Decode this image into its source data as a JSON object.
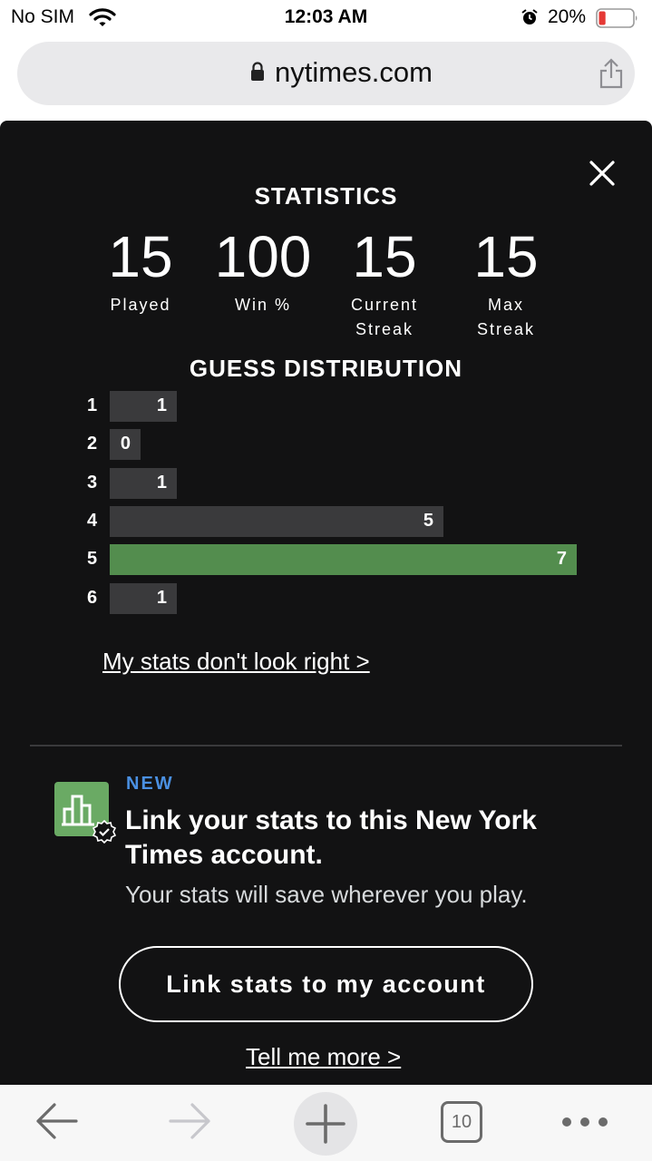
{
  "status_bar": {
    "carrier": "No SIM",
    "time": "12:03 AM",
    "battery_percent": "20%",
    "battery_level": 0.2,
    "icons": [
      "wifi-icon",
      "alarm-icon",
      "battery-icon"
    ]
  },
  "browser": {
    "url": "nytimes.com",
    "tab_count": "10",
    "icons": [
      "lock-icon",
      "share-icon",
      "back-arrow-icon",
      "forward-arrow-icon",
      "plus-icon",
      "more-dots-icon"
    ]
  },
  "modal": {
    "stats_title": "STATISTICS",
    "stats": [
      {
        "value": "15",
        "label": "Played"
      },
      {
        "value": "100",
        "label": "Win %"
      },
      {
        "value": "15",
        "label": "Current\nStreak"
      },
      {
        "value": "15",
        "label": "Max\nStreak"
      }
    ],
    "distribution_title": "GUESS DISTRIBUTION",
    "chart_data": {
      "type": "bar",
      "categories": [
        "1",
        "2",
        "3",
        "4",
        "5",
        "6"
      ],
      "values": [
        1,
        0,
        1,
        5,
        7,
        1
      ],
      "highlighted_category": "5",
      "colors": {
        "bar": "#3a3a3c",
        "highlight": "#538d4e"
      }
    },
    "stats_link": "My stats don't look right >",
    "promo": {
      "badge": "NEW",
      "title": "Link your stats to this New York Times account.",
      "subtitle": "Your stats will save wherever you play.",
      "button_label": "Link stats to my account",
      "more_link": "Tell me more >"
    },
    "colors": {
      "background": "#121213",
      "accent_green": "#6aaa64",
      "new_badge": "#4a90e2"
    }
  }
}
